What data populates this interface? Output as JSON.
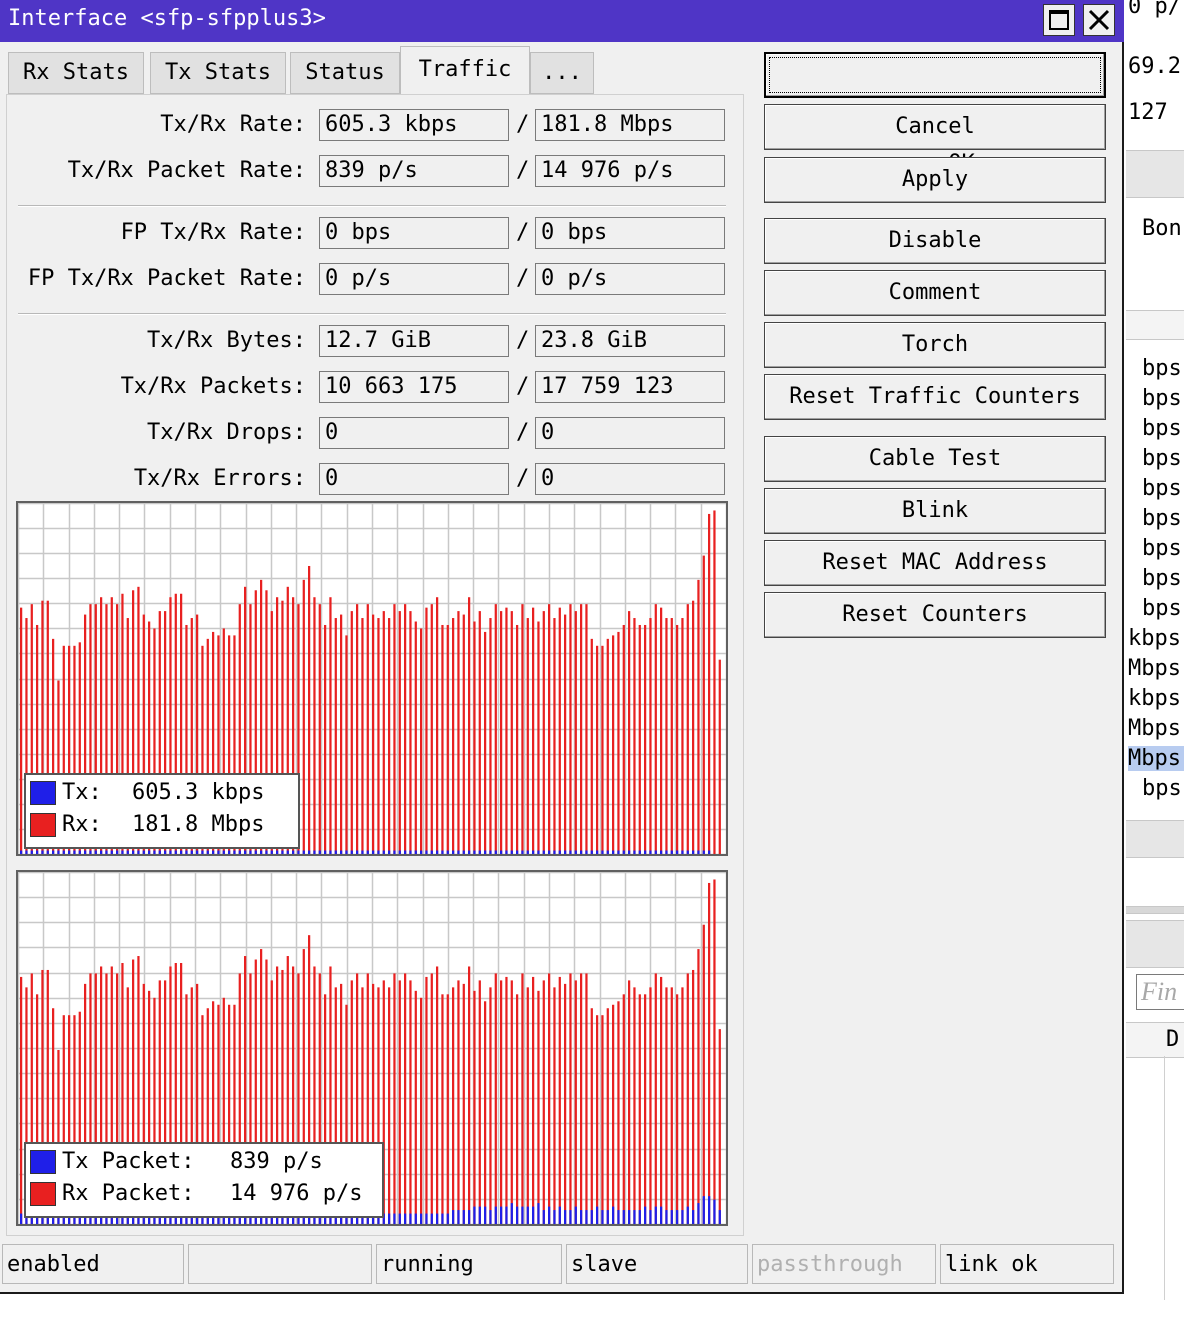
{
  "window": {
    "title": "Interface <sfp-sfpplus3>"
  },
  "tabs": [
    "Rx Stats",
    "Tx Stats",
    "Status",
    "Traffic",
    "..."
  ],
  "active_tab": "Traffic",
  "traffic": {
    "rate": {
      "label": "Tx/Rx Rate:",
      "tx": "605.3 kbps",
      "rx": "181.8 Mbps"
    },
    "packet_rate": {
      "label": "Tx/Rx Packet Rate:",
      "tx": "839 p/s",
      "rx": "14 976 p/s"
    },
    "fp_rate": {
      "label": "FP Tx/Rx Rate:",
      "tx": "0 bps",
      "rx": "0 bps"
    },
    "fp_packet_rate": {
      "label": "FP Tx/Rx Packet Rate:",
      "tx": "0 p/s",
      "rx": "0 p/s"
    },
    "bytes": {
      "label": "Tx/Rx Bytes:",
      "tx": "12.7 GiB",
      "rx": "23.8 GiB"
    },
    "packets": {
      "label": "Tx/Rx Packets:",
      "tx": "10 663 175",
      "rx": "17 759 123"
    },
    "drops": {
      "label": "Tx/Rx Drops:",
      "tx": "0",
      "rx": "0"
    },
    "errors": {
      "label": "Tx/Rx Errors:",
      "tx": "0",
      "rx": "0"
    },
    "separator": "/"
  },
  "graphs": {
    "colors": {
      "tx": "#1f1fe8",
      "rx": "#e82020",
      "grid": "#c8c8c8"
    },
    "rate_legend": {
      "tx_label": "Tx:",
      "tx_value": "605.3 kbps",
      "rx_label": "Rx:",
      "rx_value": "181.8 Mbps"
    },
    "packet_legend": {
      "tx_label": "Tx Packet:",
      "tx_value": "839 p/s",
      "rx_label": "Rx Packet:",
      "rx_value": "14 976 p/s"
    },
    "rx_levels": [
      0.71,
      0.68,
      0.72,
      0.66,
      0.73,
      0.73,
      0.62,
      0.5,
      0.6,
      0.6,
      0.6,
      0.61,
      0.69,
      0.72,
      0.72,
      0.74,
      0.72,
      0.74,
      0.72,
      0.75,
      0.68,
      0.76,
      0.77,
      0.69,
      0.67,
      0.65,
      0.7,
      0.7,
      0.74,
      0.75,
      0.75,
      0.66,
      0.68,
      0.69,
      0.6,
      0.62,
      0.64,
      0.63,
      0.65,
      0.63,
      0.63,
      0.72,
      0.77,
      0.72,
      0.76,
      0.79,
      0.76,
      0.7,
      0.74,
      0.73,
      0.77,
      0.74,
      0.72,
      0.79,
      0.83,
      0.74,
      0.72,
      0.66,
      0.74,
      0.68,
      0.69,
      0.63,
      0.7,
      0.72,
      0.68,
      0.72,
      0.69,
      0.68,
      0.7,
      0.68,
      0.72,
      0.7,
      0.72,
      0.7,
      0.67,
      0.65,
      0.71,
      0.72,
      0.74,
      0.66,
      0.66,
      0.68,
      0.7,
      0.69,
      0.74,
      0.67,
      0.7,
      0.64,
      0.68,
      0.72,
      0.7,
      0.71,
      0.7,
      0.66,
      0.72,
      0.68,
      0.71,
      0.67,
      0.7,
      0.72,
      0.68,
      0.71,
      0.69,
      0.72,
      0.7,
      0.72,
      0.72,
      0.62,
      0.6,
      0.6,
      0.62,
      0.63,
      0.64,
      0.66,
      0.7,
      0.68,
      0.66,
      0.66,
      0.68,
      0.72,
      0.71,
      0.68,
      0.68,
      0.66,
      0.68,
      0.72,
      0.73,
      0.79,
      0.86,
      0.98,
      0.99,
      0.56
    ],
    "tx_levels_rate": [
      0.01,
      0.01,
      0.01,
      0.01,
      0.01,
      0.01,
      0.01,
      0.01,
      0.01,
      0.01,
      0.01,
      0.01,
      0.01,
      0.01,
      0.01,
      0.01,
      0.01,
      0.01,
      0.01,
      0.01,
      0.01,
      0.01,
      0.01,
      0.01,
      0.01,
      0.01,
      0.01,
      0.01,
      0.01,
      0.01,
      0.01,
      0.01,
      0.01,
      0.01,
      0.01,
      0.01,
      0.01,
      0.01,
      0.01,
      0.01,
      0.01,
      0.01,
      0.01,
      0.01,
      0.01,
      0.01,
      0.01,
      0.01,
      0.01,
      0.01,
      0.01,
      0.01,
      0.01,
      0.01,
      0.01,
      0.01,
      0.01,
      0.01,
      0.01,
      0.01,
      0.01,
      0.01,
      0.01,
      0.01,
      0.01,
      0.01,
      0.01,
      0.01,
      0.01,
      0.01,
      0.01,
      0.01,
      0.01,
      0.01,
      0.01,
      0.01,
      0.01,
      0.01,
      0.01,
      0.01,
      0.01,
      0.01,
      0.01,
      0.01,
      0.01,
      0.01,
      0.01,
      0.01,
      0.01,
      0.01,
      0.01,
      0.01,
      0.01,
      0.01,
      0.01,
      0.01,
      0.01,
      0.01,
      0.01,
      0.01,
      0.01,
      0.01,
      0.01,
      0.01,
      0.01,
      0.01,
      0.01,
      0.01,
      0.01,
      0.01,
      0.01,
      0.01,
      0.01,
      0.01,
      0.01,
      0.01,
      0.01,
      0.01,
      0.01,
      0.01,
      0.01,
      0.01,
      0.01,
      0.01,
      0.01,
      0.01,
      0.01,
      0.01,
      0.01,
      0.01
    ],
    "tx_levels_packet": [
      0.03,
      0.03,
      0.03,
      0.03,
      0.03,
      0.03,
      0.03,
      0.03,
      0.03,
      0.03,
      0.03,
      0.03,
      0.03,
      0.03,
      0.03,
      0.03,
      0.03,
      0.03,
      0.03,
      0.03,
      0.03,
      0.03,
      0.03,
      0.03,
      0.03,
      0.03,
      0.03,
      0.03,
      0.03,
      0.03,
      0.03,
      0.03,
      0.03,
      0.03,
      0.03,
      0.03,
      0.03,
      0.03,
      0.03,
      0.03,
      0.03,
      0.03,
      0.03,
      0.03,
      0.03,
      0.03,
      0.03,
      0.03,
      0.03,
      0.03,
      0.03,
      0.03,
      0.03,
      0.03,
      0.03,
      0.03,
      0.03,
      0.03,
      0.03,
      0.03,
      0.03,
      0.03,
      0.03,
      0.03,
      0.03,
      0.03,
      0.03,
      0.03,
      0.03,
      0.03,
      0.03,
      0.03,
      0.03,
      0.03,
      0.03,
      0.03,
      0.03,
      0.03,
      0.03,
      0.03,
      0.03,
      0.04,
      0.04,
      0.04,
      0.04,
      0.05,
      0.05,
      0.05,
      0.04,
      0.05,
      0.05,
      0.05,
      0.06,
      0.05,
      0.05,
      0.05,
      0.05,
      0.06,
      0.04,
      0.05,
      0.04,
      0.05,
      0.04,
      0.04,
      0.05,
      0.04,
      0.04,
      0.04,
      0.05,
      0.04,
      0.04,
      0.05,
      0.04,
      0.04,
      0.04,
      0.04,
      0.04,
      0.05,
      0.04,
      0.05,
      0.05,
      0.04,
      0.04,
      0.04,
      0.04,
      0.05,
      0.04,
      0.06,
      0.08,
      0.08,
      0.07,
      0.04
    ]
  },
  "buttons": {
    "ok": "OK",
    "cancel": "Cancel",
    "apply": "Apply",
    "disable": "Disable",
    "comment": "Comment",
    "torch": "Torch",
    "reset_traffic_counters": "Reset Traffic Counters",
    "cable_test": "Cable Test",
    "blink": "Blink",
    "reset_mac": "Reset MAC Address",
    "reset_counters": "Reset Counters"
  },
  "status_bar": [
    "enabled",
    "",
    "running",
    "slave",
    "passthrough",
    "link ok"
  ],
  "background_window": {
    "top_text": "0 p/",
    "values": [
      "69.2",
      "127"
    ],
    "header": "Bon",
    "units": [
      "bps",
      "bps",
      "bps",
      "bps",
      "bps",
      "bps",
      "bps",
      "bps",
      "bps",
      "kbps",
      "Mbps",
      "kbps",
      "Mbps",
      "Mbps",
      "bps"
    ],
    "find_placeholder": "Fin",
    "col": "D"
  }
}
